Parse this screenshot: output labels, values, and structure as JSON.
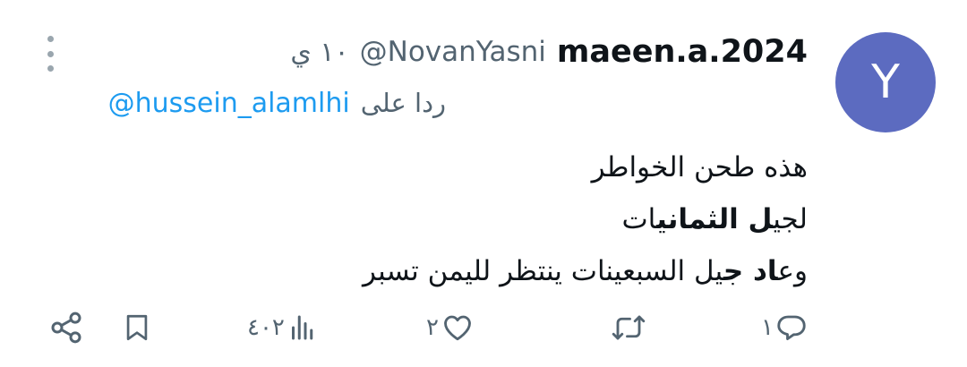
{
  "author": {
    "avatar_letter": "Y",
    "avatar_color": "#5c6bc0",
    "display_name": "maeen.a.2024",
    "handle": "@NovanYasni",
    "time_ago": "١٠ ي"
  },
  "reply": {
    "prefix": "ردا على",
    "mention": "@hussein_alamlhi"
  },
  "body": {
    "line1": "هذه طحن الخواطر",
    "line2_a": "لجي",
    "line2_b": "ل الثماني",
    "line2_c": "ات",
    "line3_a": "وع",
    "line3_b": "اد ج",
    "line3_c": "يل السبعينات ينتظر لليمن تسبر"
  },
  "actions": {
    "replies": "١",
    "retweets": "",
    "likes": "٢",
    "views": "٤٠٢"
  },
  "icons": {
    "more": "more-vertical-icon",
    "reply": "reply-icon",
    "retweet": "retweet-icon",
    "like": "heart-icon",
    "views": "views-chart-icon",
    "bookmark": "bookmark-icon",
    "share": "share-icon"
  },
  "colors": {
    "link": "#1d9bf0",
    "secondary_text": "#536471",
    "primary_text": "#0f1419"
  }
}
